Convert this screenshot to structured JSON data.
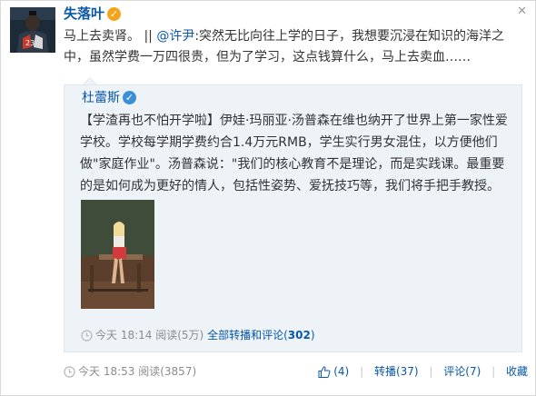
{
  "post": {
    "author": "失落叶",
    "text": "马上去卖肾。 ||",
    "mention": "@许尹",
    "text_after_mention": ":突然无比向往上学的日子，我想要沉浸在知识的海洋之中，虽然学费一万四很贵，但为了学习，这点钱算什么，马上去卖血……",
    "time": "今天 18:53",
    "views": "阅读(3857)",
    "like_count": "(4)",
    "repost_label": "转播(37)",
    "comment_label": "评论(7)",
    "favorite_label": "收藏"
  },
  "quoted": {
    "author": "杜蕾斯",
    "text": "【学渣再也不怕开学啦】伊娃·玛丽亚·汤普森在维也纳开了世界上第一家性爱学校。学校每学期学费约合1.4万元RMB，学生实行男女混住，以方便他们做\"家庭作业\"。汤普森说：\"我们的核心教育不是理论，而是实践课。最重要的是如何成为更好的情人，包括性姿势、爱抚技巧等，我们将手把手教授。",
    "time": "今天 18:14",
    "views": "阅读(5万)",
    "all_reposts_label": "全部转播和评论(",
    "all_reposts_count": "302",
    "all_reposts_close": ")"
  },
  "colors": {
    "link": "#0a57a8",
    "verified_gold": "#f2a41b",
    "verified_blue": "#3a8fd6",
    "quote_bg": "#eef3f8"
  },
  "icons": {
    "close": "close-icon",
    "verified": "verified-badge-icon",
    "clock": "clock-icon",
    "like": "thumbs-up-icon"
  }
}
